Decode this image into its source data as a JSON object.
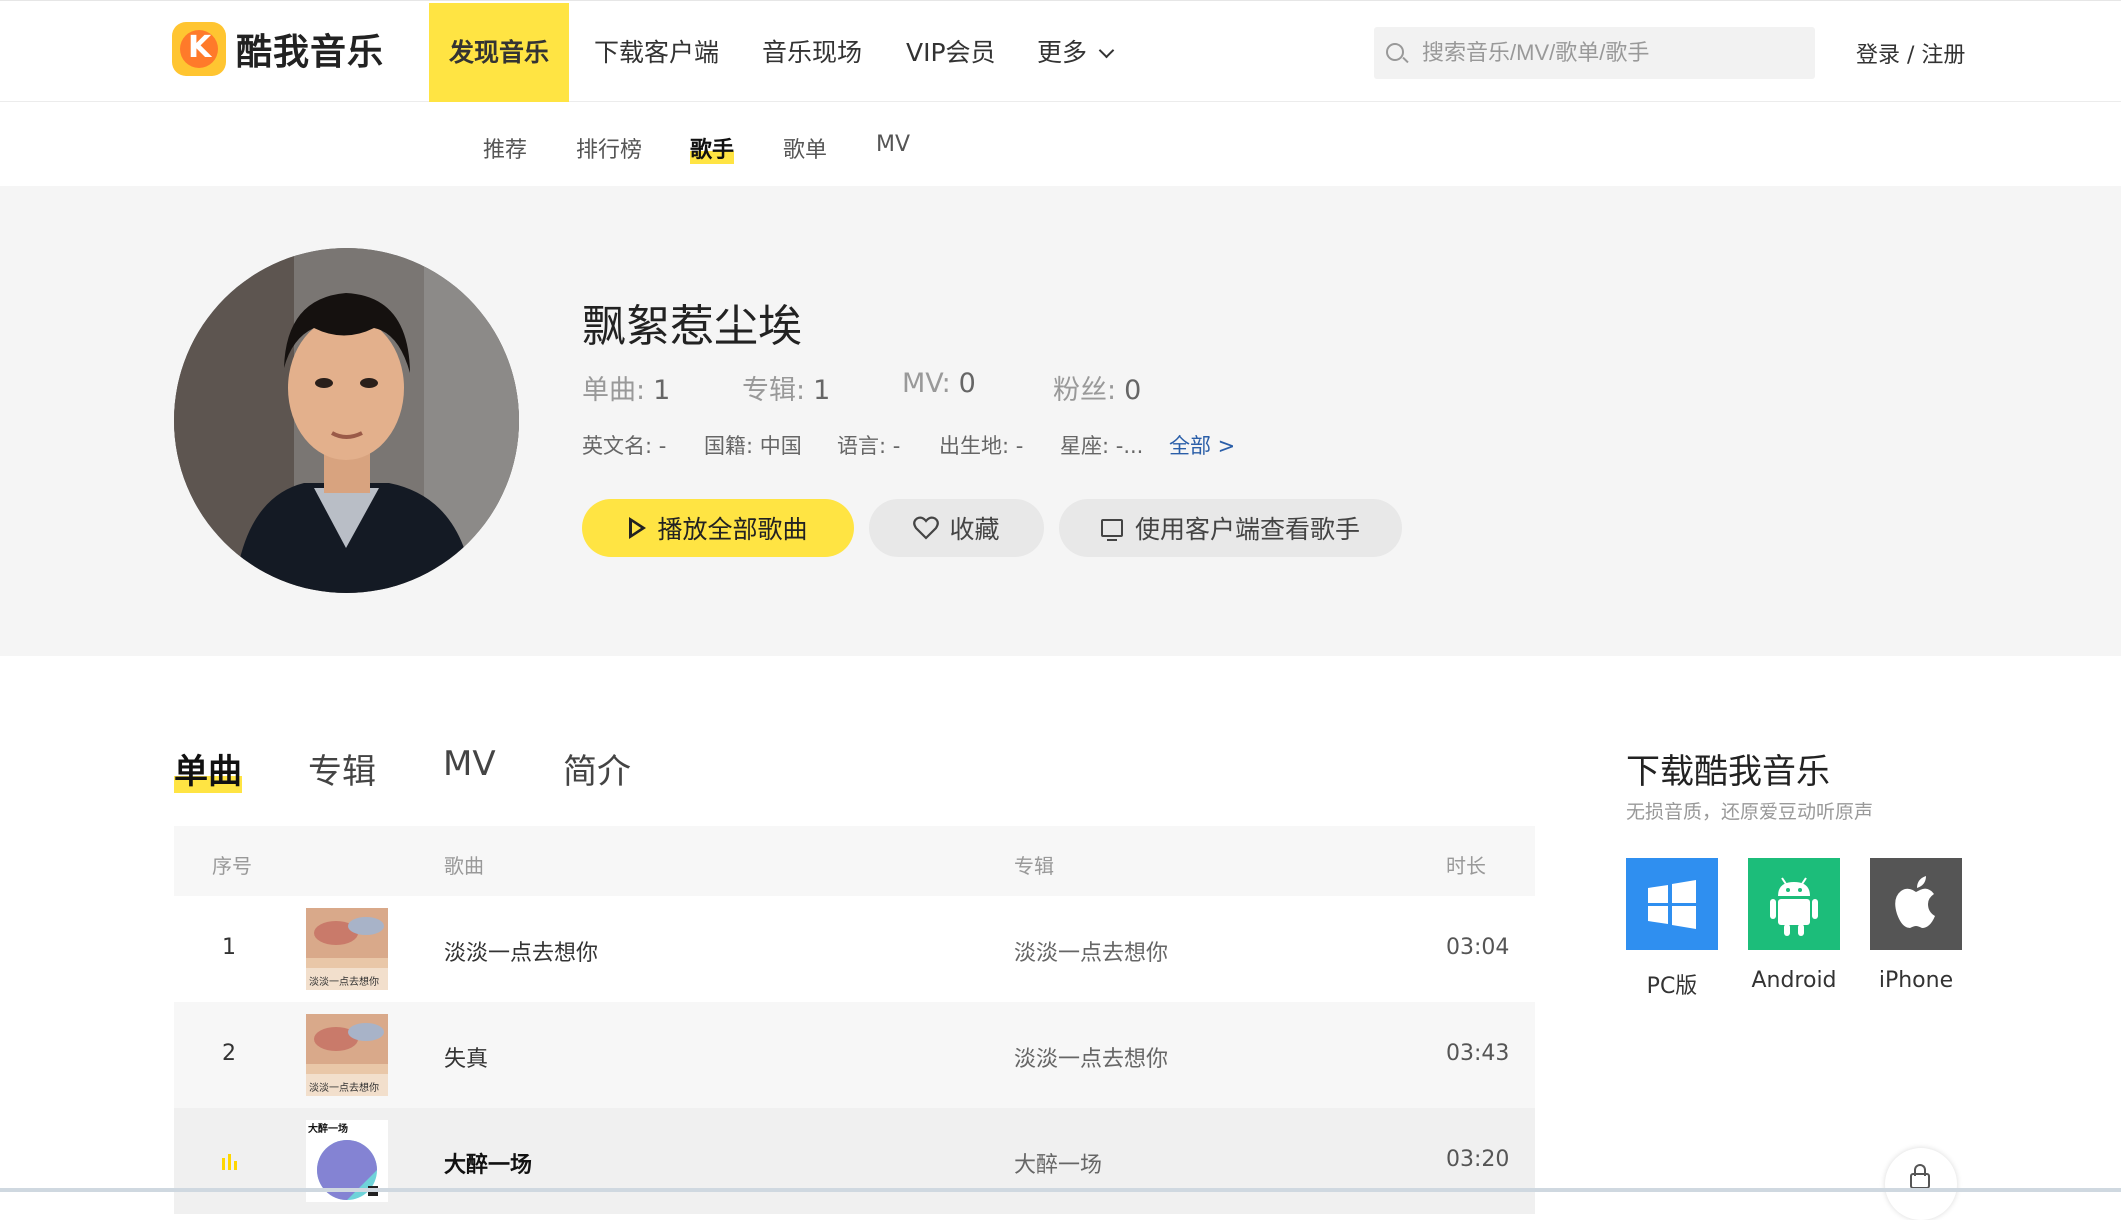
{
  "header": {
    "logo_text": "酷我音乐",
    "nav": [
      {
        "label": "发现音乐"
      },
      {
        "label": "下载客户端"
      },
      {
        "label": "音乐现场"
      },
      {
        "label": "VIP会员"
      },
      {
        "label": "更多"
      }
    ],
    "search_placeholder": "搜索音乐/MV/歌单/歌手",
    "login_label": "登录 / 注册"
  },
  "subnav": {
    "items": [
      {
        "label": "推荐"
      },
      {
        "label": "排行榜"
      },
      {
        "label": "歌手"
      },
      {
        "label": "歌单"
      },
      {
        "label": "MV"
      }
    ]
  },
  "artist": {
    "name": "飘絮惹尘埃",
    "stats": [
      {
        "label": "单曲:",
        "value": "1"
      },
      {
        "label": "专辑:",
        "value": "1"
      },
      {
        "label": "MV:",
        "value": "0"
      },
      {
        "label": "粉丝:",
        "value": "0"
      }
    ],
    "meta": [
      {
        "text": "英文名: -"
      },
      {
        "text": "国籍: 中国"
      },
      {
        "text": "语言: -"
      },
      {
        "text": "出生地: -"
      },
      {
        "text": "星座: -..."
      }
    ],
    "more_link": "全部 >",
    "buttons": {
      "play_all": "播放全部歌曲",
      "favorite": "收藏",
      "client": "使用客户端查看歌手"
    }
  },
  "tabs": [
    {
      "label": "单曲"
    },
    {
      "label": "专辑"
    },
    {
      "label": "MV"
    },
    {
      "label": "简介"
    }
  ],
  "table": {
    "headers": {
      "index": "序号",
      "song": "歌曲",
      "album": "专辑",
      "duration": "时长"
    },
    "rows": [
      {
        "index": "1",
        "song": "淡淡一点去想你",
        "album": "淡淡一点去想你",
        "duration": "03:04",
        "cover_text": "淡淡一点去想你"
      },
      {
        "index": "2",
        "song": "失真",
        "album": "淡淡一点去想你",
        "duration": "03:43",
        "cover_text": "淡淡一点去想你"
      },
      {
        "index": "",
        "song": "大醉一场",
        "album": "大醉一场",
        "duration": "03:20",
        "cover_text": "大醉一场"
      }
    ]
  },
  "download": {
    "title": "下载酷我音乐",
    "subtitle": "无损音质，还原爱豆动听原声",
    "platforms": [
      {
        "label": "PC版",
        "color": "#2f8ff0"
      },
      {
        "label": "Android",
        "color": "#1cbd7a"
      },
      {
        "label": "iPhone",
        "color": "#555555"
      }
    ]
  },
  "colors": {
    "accent": "#ffe443",
    "link": "#2a5ea8"
  }
}
